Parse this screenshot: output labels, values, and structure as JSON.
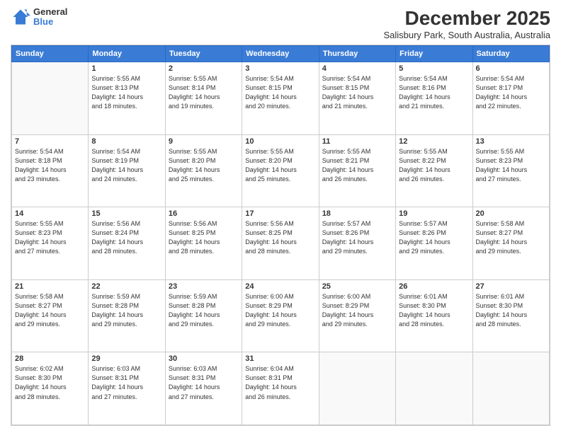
{
  "logo": {
    "general": "General",
    "blue": "Blue"
  },
  "title": "December 2025",
  "subtitle": "Salisbury Park, South Australia, Australia",
  "headers": [
    "Sunday",
    "Monday",
    "Tuesday",
    "Wednesday",
    "Thursday",
    "Friday",
    "Saturday"
  ],
  "weeks": [
    [
      {
        "day": "",
        "info": ""
      },
      {
        "day": "1",
        "info": "Sunrise: 5:55 AM\nSunset: 8:13 PM\nDaylight: 14 hours\nand 18 minutes."
      },
      {
        "day": "2",
        "info": "Sunrise: 5:55 AM\nSunset: 8:14 PM\nDaylight: 14 hours\nand 19 minutes."
      },
      {
        "day": "3",
        "info": "Sunrise: 5:54 AM\nSunset: 8:15 PM\nDaylight: 14 hours\nand 20 minutes."
      },
      {
        "day": "4",
        "info": "Sunrise: 5:54 AM\nSunset: 8:15 PM\nDaylight: 14 hours\nand 21 minutes."
      },
      {
        "day": "5",
        "info": "Sunrise: 5:54 AM\nSunset: 8:16 PM\nDaylight: 14 hours\nand 21 minutes."
      },
      {
        "day": "6",
        "info": "Sunrise: 5:54 AM\nSunset: 8:17 PM\nDaylight: 14 hours\nand 22 minutes."
      }
    ],
    [
      {
        "day": "7",
        "info": "Sunrise: 5:54 AM\nSunset: 8:18 PM\nDaylight: 14 hours\nand 23 minutes."
      },
      {
        "day": "8",
        "info": "Sunrise: 5:54 AM\nSunset: 8:19 PM\nDaylight: 14 hours\nand 24 minutes."
      },
      {
        "day": "9",
        "info": "Sunrise: 5:55 AM\nSunset: 8:20 PM\nDaylight: 14 hours\nand 25 minutes."
      },
      {
        "day": "10",
        "info": "Sunrise: 5:55 AM\nSunset: 8:20 PM\nDaylight: 14 hours\nand 25 minutes."
      },
      {
        "day": "11",
        "info": "Sunrise: 5:55 AM\nSunset: 8:21 PM\nDaylight: 14 hours\nand 26 minutes."
      },
      {
        "day": "12",
        "info": "Sunrise: 5:55 AM\nSunset: 8:22 PM\nDaylight: 14 hours\nand 26 minutes."
      },
      {
        "day": "13",
        "info": "Sunrise: 5:55 AM\nSunset: 8:23 PM\nDaylight: 14 hours\nand 27 minutes."
      }
    ],
    [
      {
        "day": "14",
        "info": "Sunrise: 5:55 AM\nSunset: 8:23 PM\nDaylight: 14 hours\nand 27 minutes."
      },
      {
        "day": "15",
        "info": "Sunrise: 5:56 AM\nSunset: 8:24 PM\nDaylight: 14 hours\nand 28 minutes."
      },
      {
        "day": "16",
        "info": "Sunrise: 5:56 AM\nSunset: 8:25 PM\nDaylight: 14 hours\nand 28 minutes."
      },
      {
        "day": "17",
        "info": "Sunrise: 5:56 AM\nSunset: 8:25 PM\nDaylight: 14 hours\nand 28 minutes."
      },
      {
        "day": "18",
        "info": "Sunrise: 5:57 AM\nSunset: 8:26 PM\nDaylight: 14 hours\nand 29 minutes."
      },
      {
        "day": "19",
        "info": "Sunrise: 5:57 AM\nSunset: 8:26 PM\nDaylight: 14 hours\nand 29 minutes."
      },
      {
        "day": "20",
        "info": "Sunrise: 5:58 AM\nSunset: 8:27 PM\nDaylight: 14 hours\nand 29 minutes."
      }
    ],
    [
      {
        "day": "21",
        "info": "Sunrise: 5:58 AM\nSunset: 8:27 PM\nDaylight: 14 hours\nand 29 minutes."
      },
      {
        "day": "22",
        "info": "Sunrise: 5:59 AM\nSunset: 8:28 PM\nDaylight: 14 hours\nand 29 minutes."
      },
      {
        "day": "23",
        "info": "Sunrise: 5:59 AM\nSunset: 8:28 PM\nDaylight: 14 hours\nand 29 minutes."
      },
      {
        "day": "24",
        "info": "Sunrise: 6:00 AM\nSunset: 8:29 PM\nDaylight: 14 hours\nand 29 minutes."
      },
      {
        "day": "25",
        "info": "Sunrise: 6:00 AM\nSunset: 8:29 PM\nDaylight: 14 hours\nand 29 minutes."
      },
      {
        "day": "26",
        "info": "Sunrise: 6:01 AM\nSunset: 8:30 PM\nDaylight: 14 hours\nand 28 minutes."
      },
      {
        "day": "27",
        "info": "Sunrise: 6:01 AM\nSunset: 8:30 PM\nDaylight: 14 hours\nand 28 minutes."
      }
    ],
    [
      {
        "day": "28",
        "info": "Sunrise: 6:02 AM\nSunset: 8:30 PM\nDaylight: 14 hours\nand 28 minutes."
      },
      {
        "day": "29",
        "info": "Sunrise: 6:03 AM\nSunset: 8:31 PM\nDaylight: 14 hours\nand 27 minutes."
      },
      {
        "day": "30",
        "info": "Sunrise: 6:03 AM\nSunset: 8:31 PM\nDaylight: 14 hours\nand 27 minutes."
      },
      {
        "day": "31",
        "info": "Sunrise: 6:04 AM\nSunset: 8:31 PM\nDaylight: 14 hours\nand 26 minutes."
      },
      {
        "day": "",
        "info": ""
      },
      {
        "day": "",
        "info": ""
      },
      {
        "day": "",
        "info": ""
      }
    ]
  ]
}
